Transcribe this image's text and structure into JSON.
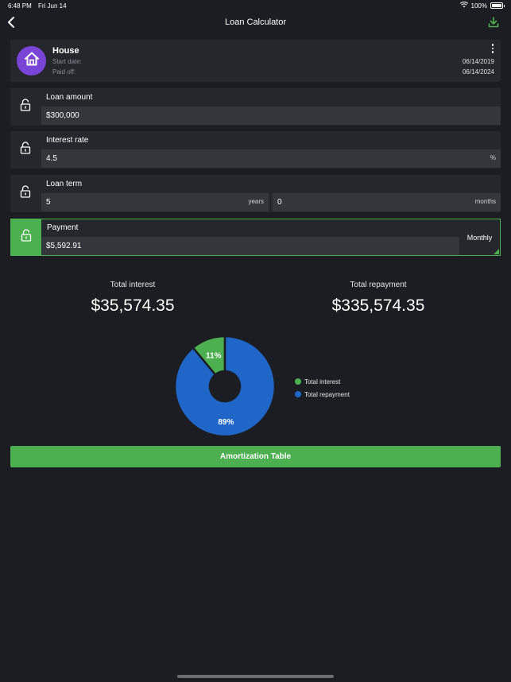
{
  "status_bar": {
    "time": "6:48 PM",
    "date": "Fri Jun 14",
    "battery": "100%"
  },
  "nav": {
    "title": "Loan Calculator",
    "back_icon": "chevron-left-icon",
    "download_icon": "download-icon"
  },
  "loan": {
    "name": "House",
    "icon": "house-icon",
    "start_label": "Start date:",
    "paid_label": "Paid off:",
    "start_date": "06/14/2019",
    "paid_date": "06/14/2024"
  },
  "fields": {
    "loan_amount": {
      "label": "Loan amount",
      "value": "$300,000"
    },
    "interest_rate": {
      "label": "Interest rate",
      "value": "4.5",
      "unit": "%"
    },
    "loan_term": {
      "label": "Loan term",
      "years_value": "5",
      "years_unit": "years",
      "months_value": "0",
      "months_unit": "months"
    },
    "payment": {
      "label": "Payment",
      "value": "$5,592.91",
      "frequency": "Monthly"
    }
  },
  "totals": {
    "interest_label": "Total interest",
    "interest_value": "$35,574.35",
    "repayment_label": "Total repayment",
    "repayment_value": "$335,574.35"
  },
  "chart_data": {
    "type": "pie",
    "donut": true,
    "categories": [
      "Total interest",
      "Total repayment"
    ],
    "values": [
      11,
      89
    ],
    "value_labels": [
      "11%",
      "89%"
    ],
    "colors": [
      "#4caf50",
      "#1f66c8"
    ],
    "legend_position": "right"
  },
  "button": {
    "amortization": "Amortization Table"
  },
  "colors": {
    "accent": "#4caf50",
    "primary_blue": "#1f66c8",
    "avatar": "#7a44d6",
    "background": "#1c1d22"
  }
}
